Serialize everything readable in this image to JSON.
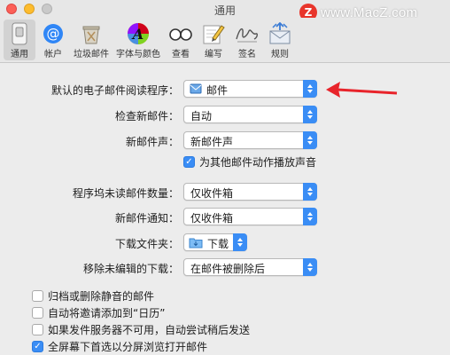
{
  "window": {
    "title": "通用"
  },
  "watermark": {
    "badge": "Z",
    "text": "www.MacZ.com"
  },
  "toolbar": {
    "items": [
      {
        "label": "通用",
        "icon": "switch-icon",
        "selected": true
      },
      {
        "label": "帐户",
        "icon": "at-sign-icon",
        "selected": false
      },
      {
        "label": "垃圾邮件",
        "icon": "junk-trash-icon",
        "selected": false
      },
      {
        "label": "字体与颜色",
        "icon": "font-color-icon",
        "selected": false
      },
      {
        "label": "查看",
        "icon": "glasses-icon",
        "selected": false
      },
      {
        "label": "编写",
        "icon": "compose-pencil-icon",
        "selected": false
      },
      {
        "label": "签名",
        "icon": "signature-icon",
        "selected": false
      },
      {
        "label": "规则",
        "icon": "rules-envelope-icon",
        "selected": false
      }
    ]
  },
  "settings": {
    "default_reader": {
      "label": "默认的电子邮件阅读程序：",
      "value": "邮件",
      "icon": "mail-app-icon"
    },
    "check_mail": {
      "label": "检查新邮件：",
      "value": "自动"
    },
    "new_mail_sound": {
      "label": "新邮件声：",
      "value": "新邮件声"
    },
    "play_sounds": {
      "label": "为其他邮件动作播放声音",
      "checked": true
    },
    "dock_unread": {
      "label": "程序坞未读邮件数量：",
      "value": "仅收件箱"
    },
    "new_mail_notify": {
      "label": "新邮件通知：",
      "value": "仅收件箱"
    },
    "downloads_folder": {
      "label": "下载文件夹：",
      "value": "下载",
      "icon": "folder-icon"
    },
    "remove_downloads": {
      "label": "移除未编辑的下载：",
      "value": "在邮件被删除后"
    }
  },
  "checkboxes": [
    {
      "label": "归档或删除静音的邮件",
      "checked": false
    },
    {
      "label": "自动将邀请添加到“日历”",
      "checked": false
    },
    {
      "label": "如果发件服务器不可用，自动尝试稍后发送",
      "checked": false
    },
    {
      "label": "全屏幕下首选以分屏浏览打开邮件",
      "checked": true
    }
  ],
  "annotation": {
    "arrow_color": "#e8242b"
  }
}
